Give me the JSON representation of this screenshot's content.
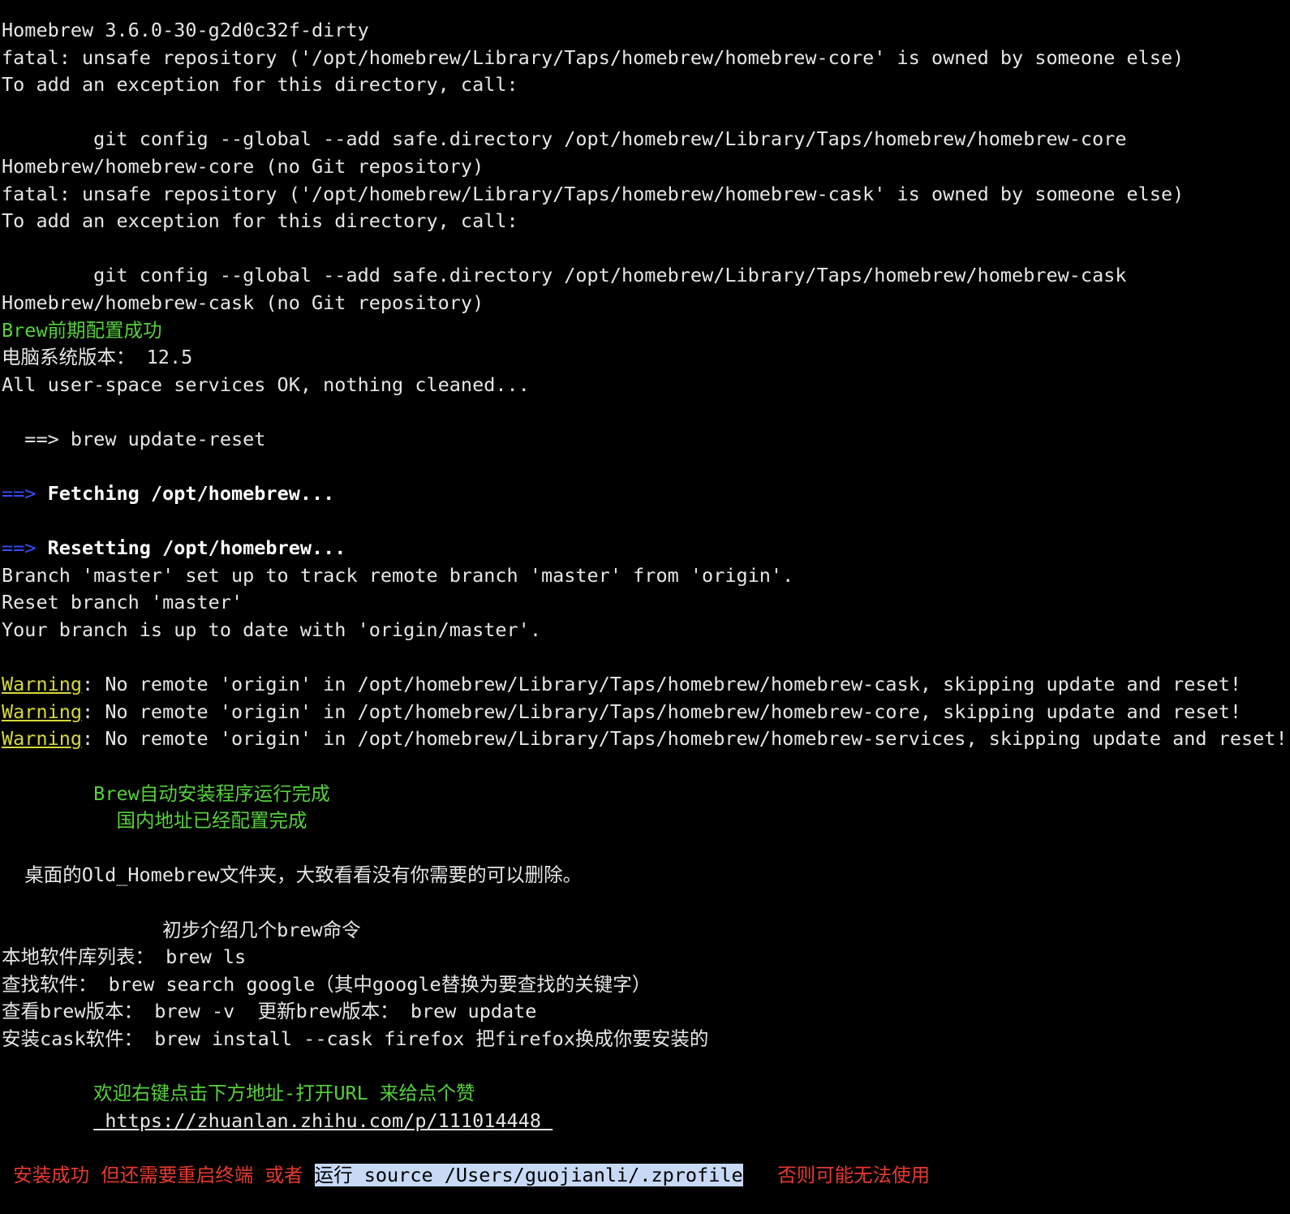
{
  "lines": [
    "Homebrew 3.6.0-30-g2d0c32f-dirty",
    "fatal: unsafe repository ('/opt/homebrew/Library/Taps/homebrew/homebrew-core' is owned by someone else)",
    "To add an exception for this directory, call:",
    "",
    "        git config --global --add safe.directory /opt/homebrew/Library/Taps/homebrew/homebrew-core",
    "Homebrew/homebrew-core (no Git repository)",
    "fatal: unsafe repository ('/opt/homebrew/Library/Taps/homebrew/homebrew-cask' is owned by someone else)",
    "To add an exception for this directory, call:",
    "",
    "        git config --global --add safe.directory /opt/homebrew/Library/Taps/homebrew/homebrew-cask",
    "Homebrew/homebrew-cask (no Git repository)",
    "Brew前期配置成功",
    "电脑系统版本： 12.5",
    "All user-space services OK, nothing cleaned...",
    "",
    "  ==> brew update-reset",
    "",
    "",
    "",
    "",
    "Branch 'master' set up to track remote branch 'master' from 'origin'.",
    "Reset branch 'master'",
    "Your branch is up to date with 'origin/master'.",
    "",
    "",
    "",
    "",
    "",
    "        Brew自动安装程序运行完成",
    "          国内地址已经配置完成",
    "",
    "  桌面的Old_Homebrew文件夹，大致看看没有你需要的可以删除。",
    "",
    "              初步介绍几个brew命令",
    "本地软件库列表： brew ls",
    "查找软件： brew search google（其中google替换为要查找的关键字）",
    "查看brew版本： brew -v  更新brew版本： brew update",
    "安装cask软件： brew install --cask firefox 把firefox换成你要安装的",
    "",
    "        欢迎右键点击下方地址-打开URL 来给点个赞",
    ""
  ],
  "fetching": {
    "arrow": "==>",
    "text": " Fetching /opt/homebrew..."
  },
  "resetting": {
    "arrow": "==>",
    "text": " Resetting /opt/homebrew..."
  },
  "warnings": [
    {
      "label": "Warning",
      "text": ": No remote 'origin' in /opt/homebrew/Library/Taps/homebrew/homebrew-cask, skipping update and reset!"
    },
    {
      "label": "Warning",
      "text": ": No remote 'origin' in /opt/homebrew/Library/Taps/homebrew/homebrew-core, skipping update and reset!"
    },
    {
      "label": "Warning",
      "text": ": No remote 'origin' in /opt/homebrew/Library/Taps/homebrew/homebrew-services, skipping update and reset!"
    }
  ],
  "url": {
    "indent": "        ",
    "text": " https://zhuanlan.zhihu.com/p/111014448 "
  },
  "final_line": {
    "prefix": " 安装成功 但还需要重启终端 或者 ",
    "highlighted": "运行 source /Users/guojianli/.zprofile",
    "suffix": "   否则可能无法使用"
  },
  "colors": {
    "background": "#000000",
    "text": "#e6e6e6",
    "green": "#55d13a",
    "arrow_blue": "#3a4cff",
    "warning_yellow": "#d8d83a",
    "red": "#e8392f",
    "highlight": "#c7d9f5"
  }
}
